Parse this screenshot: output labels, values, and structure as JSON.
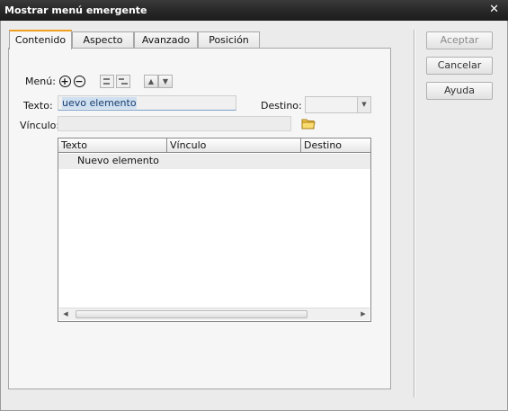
{
  "window": {
    "title": "Mostrar menú emergente",
    "close_glyph": "✕"
  },
  "tabs": [
    {
      "label": "Contenido",
      "active": true
    },
    {
      "label": "Aspecto",
      "active": false
    },
    {
      "label": "Avanzado",
      "active": false
    },
    {
      "label": "Posición",
      "active": false
    }
  ],
  "form": {
    "menu_label": "Menú:",
    "texto_label": "Texto:",
    "texto_value": "uevo elemento",
    "destino_label": "Destino:",
    "destino_value": "",
    "vinculo_label": "Vínculo:",
    "vinculo_value": ""
  },
  "table": {
    "columns": [
      "Texto",
      "Vínculo",
      "Destino"
    ],
    "rows": [
      {
        "texto": "Nuevo elemento",
        "vinculo": "",
        "destino": ""
      }
    ]
  },
  "buttons": {
    "accept": "Aceptar",
    "cancel": "Cancelar",
    "help": "Ayuda"
  },
  "icons": {
    "add": "plus-icon",
    "remove": "minus-icon",
    "indent_out": "outdent-icon",
    "indent_in": "indent-icon",
    "move_up": "arrow-up-icon",
    "move_down": "arrow-down-icon",
    "browse": "folder-icon"
  },
  "colors": {
    "titlebar": "#2a2a2a",
    "active_tab_accent": "#f0a020",
    "selection": "#cfe0f1"
  }
}
